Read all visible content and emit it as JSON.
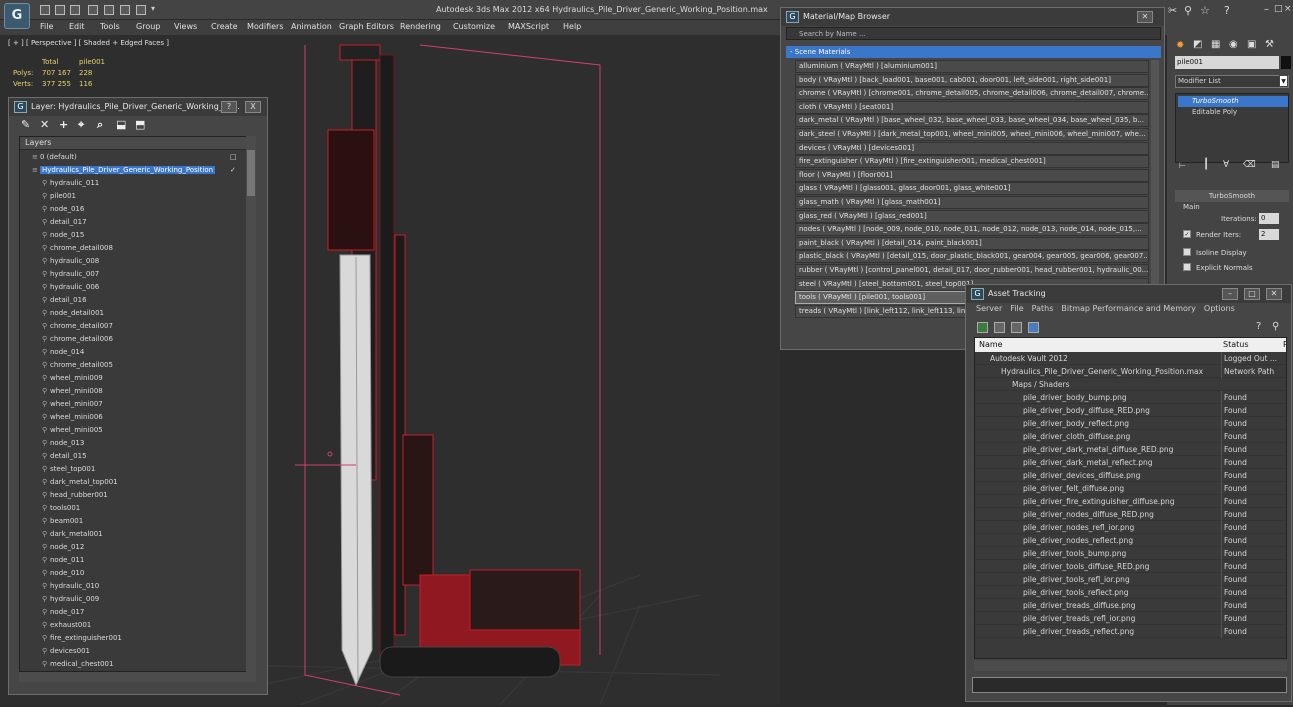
{
  "app": {
    "logo": "G",
    "title": "Autodesk 3ds Max  2012 x64     Hydraulics_Pile_Driver_Generic_Working_Position.max"
  },
  "menu": [
    "File",
    "Edit",
    "Tools",
    "Group",
    "Views",
    "Create",
    "Modifiers",
    "Animation",
    "Graph Editors",
    "Rendering",
    "Customize",
    "MAXScript",
    "Help"
  ],
  "viewport": {
    "label": "[ + ] [ Perspective ] [ Shaded + Edged Faces ]",
    "stats": {
      "total_label": "Total",
      "object": "pile001",
      "polys_label": "Polys:",
      "polys_total": "707 167",
      "polys_obj": "228",
      "verts_label": "Verts:",
      "verts_total": "377 255",
      "verts_obj": "116"
    }
  },
  "layer_window": {
    "title": "Layer: Hydraulics_Pile_Driver_Generic_Working_Po...",
    "help": "?",
    "close": "X",
    "header": "Layers",
    "rows": [
      "0 (default)",
      "Hydraulics_Pile_Driver_Generic_Working_Position",
      "hydraulic_011",
      "pile001",
      "node_016",
      "detail_017",
      "node_015",
      "chrome_detail008",
      "hydraulic_008",
      "hydraulic_007",
      "hydraulic_006",
      "detail_016",
      "node_detail001",
      "chrome_detail007",
      "chrome_detail006",
      "node_014",
      "chrome_detail005",
      "wheel_mini009",
      "wheel_mini008",
      "wheel_mini007",
      "wheel_mini006",
      "wheel_mini005",
      "node_013",
      "detail_015",
      "steel_top001",
      "dark_metal_top001",
      "head_rubber001",
      "tools001",
      "beam001",
      "dark_metal001",
      "node_012",
      "node_011",
      "node_010",
      "hydraulic_010",
      "hydraulic_009",
      "node_017",
      "exhaust001",
      "fire_extinguisher001",
      "devices001",
      "medical_chest001"
    ]
  },
  "material_browser": {
    "title": "Material/Map Browser",
    "search": "Search by Name ...",
    "section": "- Scene Materials",
    "rows": [
      "alluminium  ( VRayMtl ) [aluminium001]",
      "body  ( VRayMtl ) [back_load001, base001, cab001, door001, left_side001, right_side001]",
      "chrome  ( VRayMtl ) [chrome001, chrome_detail005, chrome_detail006, chrome_detail007, chrome...",
      "cloth  ( VRayMtl ) [seat001]",
      "dark_metal  ( VRayMtl ) [base_wheel_032, base_wheel_033, base_wheel_034, base_wheel_035, b...",
      "dark_steel  ( VRayMtl ) [dark_metal_top001, wheel_mini005, wheel_mini006, wheel_mini007, whe...",
      "devices  ( VRayMtl ) [devices001]",
      "fire_extinguisher  ( VRayMtl ) [fire_extinguisher001, medical_chest001]",
      "floor  ( VRayMtl ) [floor001]",
      "glass  ( VRayMtl ) [glass001, glass_door001, glass_white001]",
      "glass_math  ( VRayMtl ) [glass_math001]",
      "glass_red  ( VRayMtl ) [glass_red001]",
      "nodes  ( VRayMtl ) [node_009, node_010, node_011, node_012, node_013, node_014, node_015,...",
      "paint_black  ( VRayMtl ) [detail_014, paint_black001]",
      "plastic_black  ( VRayMtl ) [detail_015, door_plastic_black001, gear004, gear005, gear006, gear007...",
      "rubber  ( VRayMtl ) [control_panel001, detail_017, door_rubber001, head_rubber001, hydraulic_00...",
      "steel  ( VRayMtl ) [steel_bottom001, steel_top001]",
      "tools  ( VRayMtl ) [pile001, tools001]",
      "treads  ( VRayMtl ) [link_left112, link_left113, link_left114, link_left115]"
    ]
  },
  "command_panel": {
    "object_name": "pile001",
    "modifier_list": "Modifier List",
    "stack": [
      "TurboSmooth",
      "Editable Poly"
    ],
    "rollout": "TurboSmooth",
    "main": "Main",
    "iterations_label": "Iterations:",
    "iterations": "0",
    "render_iters_label": "Render Iters:",
    "render_iters": "2",
    "isoline": "Isoline Display",
    "explicit": "Explicit Normals"
  },
  "asset_tracking": {
    "title": "Asset Tracking",
    "menu": [
      "Server",
      "File",
      "Paths",
      "Bitmap Performance and Memory",
      "Options"
    ],
    "col_name": "Name",
    "col_status": "Status",
    "col_extra": "P",
    "rows": [
      {
        "name": "Autodesk Vault 2012",
        "status": "Logged Out ...",
        "indent": 1
      },
      {
        "name": "Hydraulics_Pile_Driver_Generic_Working_Position.max",
        "status": "Network Path",
        "indent": 2
      },
      {
        "name": "Maps / Shaders",
        "status": "",
        "indent": 3
      },
      {
        "name": "pile_driver_body_bump.png",
        "status": "Found",
        "indent": 4
      },
      {
        "name": "pile_driver_body_diffuse_RED.png",
        "status": "Found",
        "indent": 4
      },
      {
        "name": "pile_driver_body_reflect.png",
        "status": "Found",
        "indent": 4
      },
      {
        "name": "pile_driver_cloth_diffuse.png",
        "status": "Found",
        "indent": 4
      },
      {
        "name": "pile_driver_dark_metal_diffuse_RED.png",
        "status": "Found",
        "indent": 4
      },
      {
        "name": "pile_driver_dark_metal_reflect.png",
        "status": "Found",
        "indent": 4
      },
      {
        "name": "pile_driver_devices_diffuse.png",
        "status": "Found",
        "indent": 4
      },
      {
        "name": "pile_driver_felt_diffuse.png",
        "status": "Found",
        "indent": 4
      },
      {
        "name": "pile_driver_fire_extinguisher_diffuse.png",
        "status": "Found",
        "indent": 4
      },
      {
        "name": "pile_driver_nodes_diffuse_RED.png",
        "status": "Found",
        "indent": 4
      },
      {
        "name": "pile_driver_nodes_refl_ior.png",
        "status": "Found",
        "indent": 4
      },
      {
        "name": "pile_driver_nodes_reflect.png",
        "status": "Found",
        "indent": 4
      },
      {
        "name": "pile_driver_tools_bump.png",
        "status": "Found",
        "indent": 4
      },
      {
        "name": "pile_driver_tools_diffuse_RED.png",
        "status": "Found",
        "indent": 4
      },
      {
        "name": "pile_driver_tools_refl_ior.png",
        "status": "Found",
        "indent": 4
      },
      {
        "name": "pile_driver_tools_reflect.png",
        "status": "Found",
        "indent": 4
      },
      {
        "name": "pile_driver_treads_diffuse.png",
        "status": "Found",
        "indent": 4
      },
      {
        "name": "pile_driver_treads_refl_ior.png",
        "status": "Found",
        "indent": 4
      },
      {
        "name": "pile_driver_treads_reflect.png",
        "status": "Found",
        "indent": 4
      }
    ]
  },
  "colors": {
    "accent": "#3a76c9",
    "machine_red": "#c81e2a",
    "pile": "#d9d9d9",
    "stats": "#e8d36a"
  }
}
